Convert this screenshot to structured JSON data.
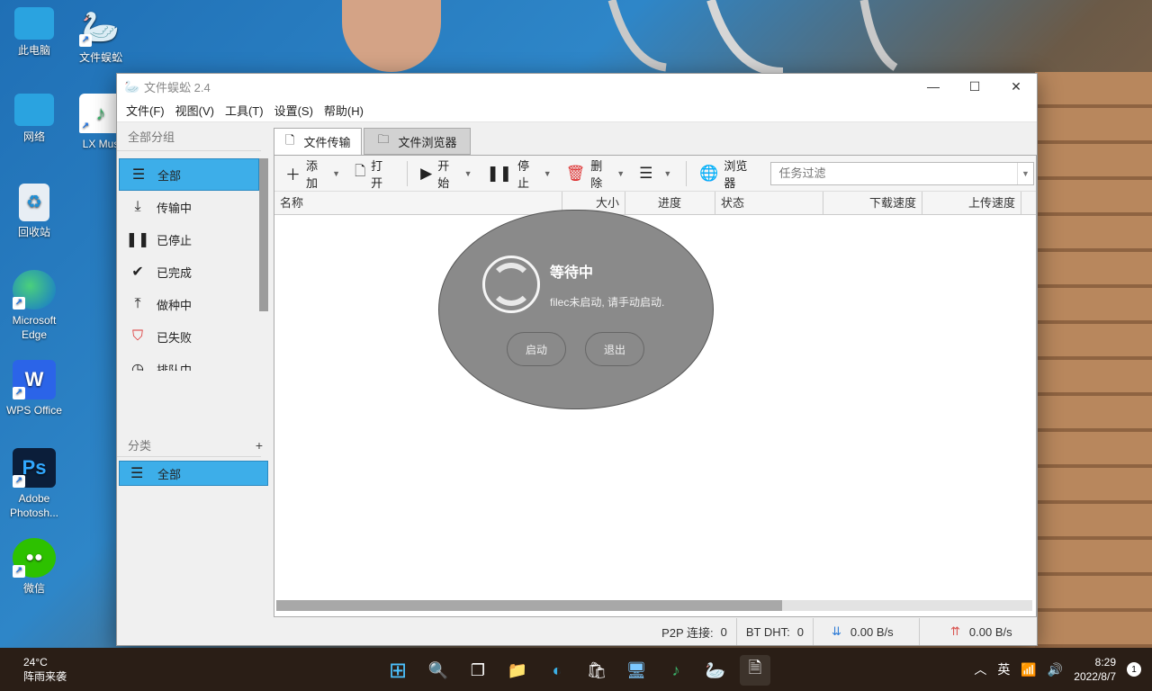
{
  "desktop": {
    "icons": [
      {
        "label": "此电脑",
        "icon": "computer-icon"
      },
      {
        "label": "文件蜈蚣",
        "icon": "goose-icon"
      },
      {
        "label": "网络",
        "icon": "network-icon"
      },
      {
        "label": "LX Mus",
        "icon": "music-icon"
      },
      {
        "label": "回收站",
        "icon": "recycle-bin-icon"
      },
      {
        "label": "Microsoft Edge",
        "icon": "edge-icon"
      },
      {
        "label": "WPS Office",
        "icon": "wps-icon"
      },
      {
        "label": "Adobe Photosh...",
        "icon": "photoshop-icon"
      },
      {
        "label": "微信",
        "icon": "wechat-icon"
      }
    ]
  },
  "window": {
    "title": "文件蜈蚣 2.4",
    "menu": [
      "文件(F)",
      "视图(V)",
      "工具(T)",
      "设置(S)",
      "帮助(H)"
    ]
  },
  "sidebar": {
    "group_header": "全部分组",
    "items": [
      {
        "label": "全部",
        "icon": "list-icon",
        "selected": true
      },
      {
        "label": "传输中",
        "icon": "download-icon"
      },
      {
        "label": "已停止",
        "icon": "pause-icon"
      },
      {
        "label": "已完成",
        "icon": "check-icon"
      },
      {
        "label": "做种中",
        "icon": "upload-icon"
      },
      {
        "label": "已失败",
        "icon": "error-shield-icon"
      },
      {
        "label": "排队中",
        "icon": "queue-icon"
      }
    ],
    "category_header": "分类",
    "category_add": "+",
    "category_items": [
      {
        "label": "全部",
        "icon": "list-icon",
        "selected": true
      }
    ]
  },
  "tabs": [
    {
      "label": "文件传输",
      "icon": "file-icon",
      "active": true
    },
    {
      "label": "文件浏览器",
      "icon": "folder-icon",
      "active": false
    }
  ],
  "toolbar": {
    "add": "添加",
    "open": "打开",
    "start": "开始",
    "stop": "停止",
    "delete": "删除",
    "browser": "浏览器",
    "filter_placeholder": "任务过滤"
  },
  "table": {
    "columns": [
      "名称",
      "大小",
      "进度",
      "状态",
      "下载速度",
      "上传速度"
    ]
  },
  "waiting": {
    "title": "等待中",
    "message": "filec未启动, 请手动启动.",
    "start_button": "启动",
    "exit_button": "退出"
  },
  "statusbar": {
    "p2p_label": "P2P 连接:",
    "p2p_value": "0",
    "dht_label": "BT DHT:",
    "dht_value": "0",
    "down_speed": "0.00 B/s",
    "up_speed": "0.00 B/s",
    "down_color": "#2e7bd6",
    "up_color": "#d9534f"
  },
  "taskbar": {
    "temperature": "24°C",
    "weather": "阵雨来袭",
    "ime": "英",
    "time": "8:29",
    "date": "2022/8/7",
    "notifications": "1"
  },
  "colors": {
    "accent": "#3daee9",
    "dialog": "#8a8a8a"
  }
}
